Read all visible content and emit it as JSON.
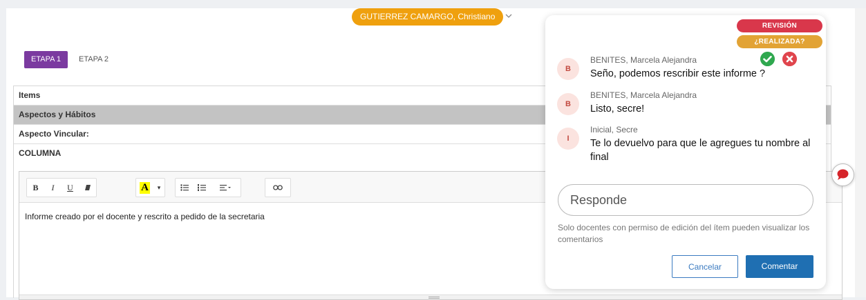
{
  "student": {
    "name": "GUTIERREZ CAMARGO, Christiano",
    "chevron_icon": "chevron-down-icon"
  },
  "stages": [
    {
      "label": "ETAPA 1",
      "active": true
    },
    {
      "label": "ETAPA 2",
      "active": false
    }
  ],
  "form": {
    "items_header": "Items",
    "section": "Aspectos y Hábitos",
    "aspect": "Aspecto Vincular:",
    "column": "COLUMNA"
  },
  "toolbar": {
    "bold": "B",
    "italic": "I",
    "underline": "U",
    "text_color": "A",
    "highlight_color": "#ffff00"
  },
  "editor": {
    "content": "Informe creado por el docente y rescrito a pedido de la secretaria"
  },
  "comments_panel": {
    "revision_label": "REVISIÓN",
    "done_label": "¿REALIZADA?",
    "comments": [
      {
        "initial": "B",
        "author": "BENITES, Marcela Alejandra",
        "text": "Seño, podemos rescribir este informe ?"
      },
      {
        "initial": "B",
        "author": "BENITES, Marcela Alejandra",
        "text": "Listo, secre!"
      },
      {
        "initial": "I",
        "author": "Inicial, Secre",
        "text": "Te lo devuelvo para que le agregues tu nombre al final"
      }
    ],
    "reply_placeholder": "Responde",
    "note": "Solo docentes con permiso de edición del ítem pueden visualizar los comentarios",
    "cancel_label": "Cancelar",
    "comment_label": "Comentar"
  },
  "colors": {
    "student_pill": "#efa00e",
    "stage_active": "#7b3aa0",
    "revision_badge": "#d9374b",
    "done_badge": "#e2a335",
    "accept": "#2fa84f",
    "reject": "#e0454d",
    "primary_button": "#1f6fb2"
  }
}
